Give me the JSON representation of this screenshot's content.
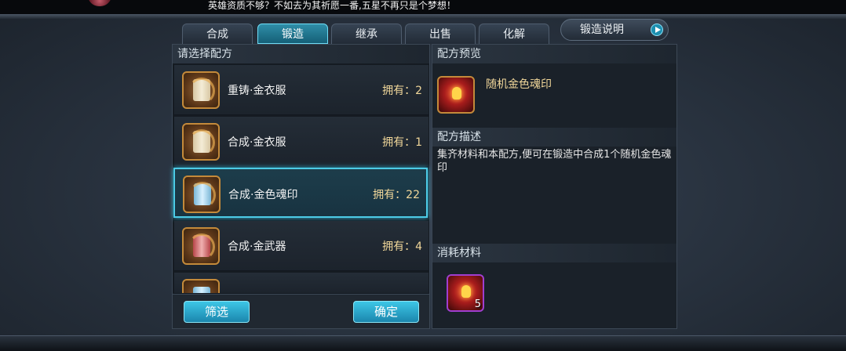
{
  "banner": {
    "message": "英雄资质不够？不如去为其祈愿一番,五星不再只是个梦想！"
  },
  "tabs": [
    {
      "label": "合成",
      "active": false
    },
    {
      "label": "锻造",
      "active": true
    },
    {
      "label": "继承",
      "active": false
    },
    {
      "label": "出售",
      "active": false
    },
    {
      "label": "化解",
      "active": false
    }
  ],
  "help_button": {
    "label": "锻造说明"
  },
  "left_panel": {
    "title": "请选择配方",
    "recipes": [
      {
        "name": "重铸·金衣服",
        "count": "拥有：2",
        "icon": "scroll-icon",
        "selected": false
      },
      {
        "name": "合成·金衣服",
        "count": "拥有：1",
        "icon": "scroll-icon",
        "selected": false
      },
      {
        "name": "合成·金色魂印",
        "count": "拥有：22",
        "icon": "blue-scroll-icon",
        "selected": true
      },
      {
        "name": "合成·金武器",
        "count": "拥有：4",
        "icon": "red-scroll-icon",
        "selected": false
      }
    ],
    "filter_label": "筛选",
    "confirm_label": "确定"
  },
  "right_panel": {
    "preview_title": "配方预览",
    "preview_item": "随机金色魂印",
    "desc_title": "配方描述",
    "desc_text": "集齐材料和本配方,便可在锻造中合成1个随机金色魂印",
    "materials_title": "消耗材料",
    "material_qty": "5"
  },
  "colors": {
    "accent": "#4ccbe6",
    "gold_text": "#f1d79a",
    "panel_bg": "#151b22"
  }
}
